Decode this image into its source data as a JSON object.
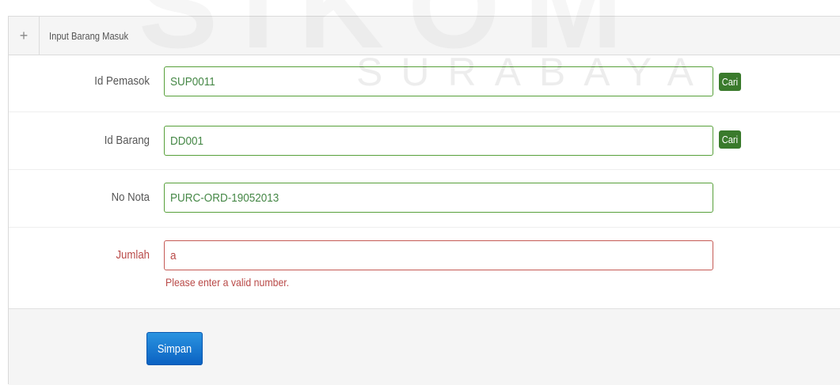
{
  "watermark": {
    "brand": "SIKOM",
    "city": "SURABAYA"
  },
  "panel": {
    "title": "Input Barang Masuk",
    "collapse_icon": "plus-icon"
  },
  "fields": {
    "id_pemasok": {
      "label": "Id Pemasok",
      "value": "SUP0011",
      "button": "Cari"
    },
    "id_barang": {
      "label": "Id Barang",
      "value": "DD001",
      "button": "Cari"
    },
    "no_nota": {
      "label": "No Nota",
      "value": "PURC-ORD-19052013"
    },
    "jumlah": {
      "label": "Jumlah",
      "value": "a",
      "error": "Please enter a valid number."
    }
  },
  "actions": {
    "submit_label": "Simpan"
  },
  "colors": {
    "valid_border": "#57a03a",
    "error_text": "#b94a48",
    "cari_button": "#3a7a2c",
    "submit_button": "#0b62c2"
  }
}
